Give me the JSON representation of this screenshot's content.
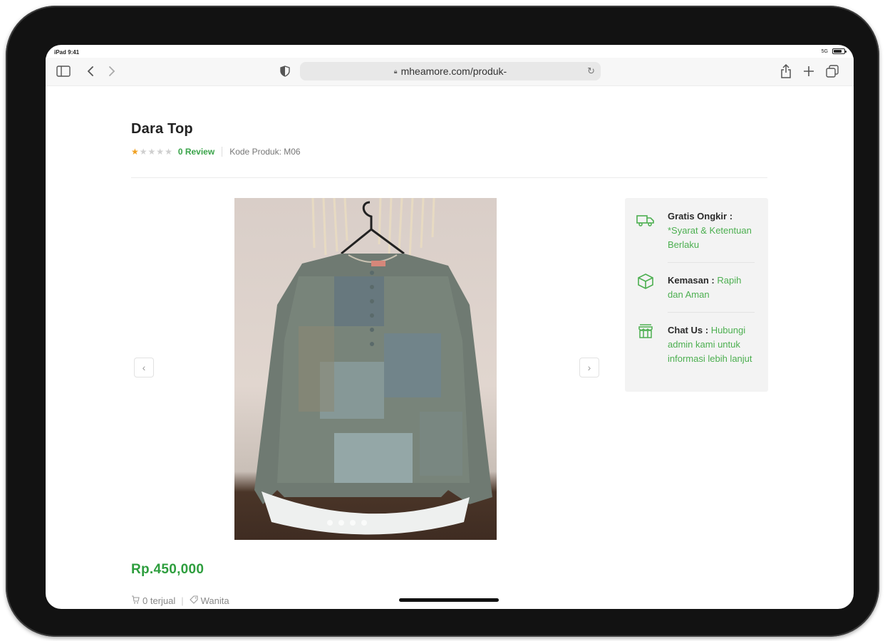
{
  "status": {
    "time": "iPad 9:41",
    "network": "5G"
  },
  "browser": {
    "url": "mheamore.com/produk-"
  },
  "product": {
    "title": "Dara Top",
    "rating": 1,
    "review_label": "0 Review",
    "code_label": "Kode Produk: M06",
    "price": "Rp.450,000",
    "sold_label": "0 terjual",
    "category_label": "Wanita"
  },
  "info": {
    "shipping_title": "Gratis Ongkir :",
    "shipping_text": "*Syarat & Ketentuan Berlaku",
    "packaging_title": "Kemasan :",
    "packaging_text": "Rapih dan Aman",
    "chat_title": "Chat Us :",
    "chat_text": "Hubungi admin kami untuk informasi lebih lanjut"
  },
  "colors": {
    "accent": "#3aa44a",
    "price": "#2e9e3e",
    "star": "#f0a020"
  },
  "icons": [
    "sidebar-icon",
    "back-icon",
    "forward-icon",
    "shield-icon",
    "lock-icon",
    "reload-icon",
    "share-icon",
    "plus-icon",
    "tabs-icon",
    "truck-icon",
    "box-icon",
    "store-icon",
    "cart-icon",
    "tag-icon"
  ]
}
